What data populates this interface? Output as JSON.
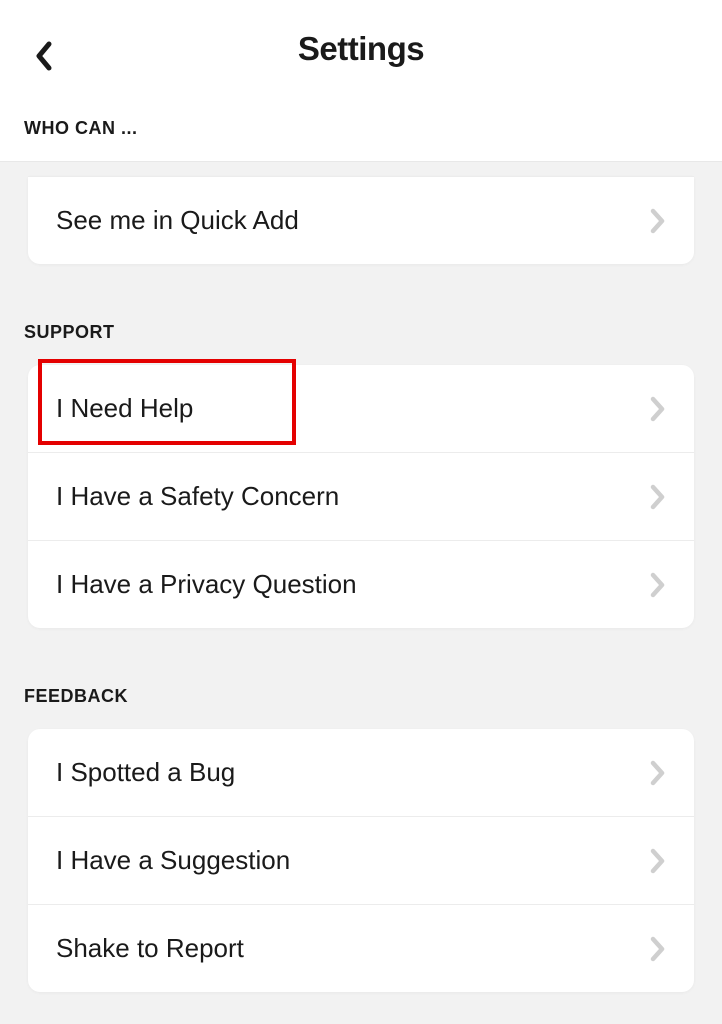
{
  "header": {
    "title": "Settings"
  },
  "sections": {
    "who_can": {
      "label": "WHO CAN ...",
      "items": [
        "See me in Quick Add"
      ]
    },
    "support": {
      "label": "SUPPORT",
      "items": [
        "I Need Help",
        "I Have a Safety Concern",
        "I Have a Privacy Question"
      ]
    },
    "feedback": {
      "label": "FEEDBACK",
      "items": [
        "I Spotted a Bug",
        "I Have a Suggestion",
        "Shake to Report"
      ]
    }
  }
}
